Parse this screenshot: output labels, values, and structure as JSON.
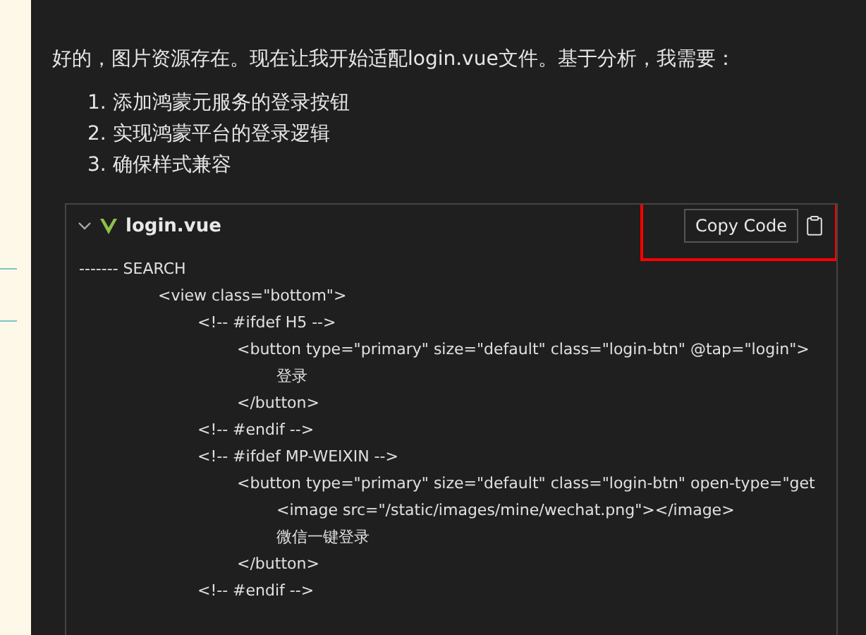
{
  "message": {
    "text": "好的，图片资源存在。现在让我开始适配login.vue文件。基于分析，我需要：",
    "steps": [
      "1. 添加鸿蒙元服务的登录按钮",
      "2. 实现鸿蒙平台的登录逻辑",
      "3. 确保样式兼容"
    ]
  },
  "code_block": {
    "filename": "login.vue",
    "expanded": true,
    "copy_label": "Copy Code",
    "highlighted": true,
    "lines": [
      {
        "text": "------- SEARCH",
        "children": [
          {
            "text": "<view class=\"bottom\">",
            "children": [
              {
                "text": "<!-- #ifdef H5 -->",
                "children": [
                  {
                    "text": "<button type=\"primary\" size=\"default\" class=\"login-btn\" @tap=\"login\">",
                    "children": [
                      {
                        "text": "登录"
                      }
                    ]
                  },
                  {
                    "text": "</button>"
                  }
                ]
              },
              {
                "text": "<!-- #endif -->"
              },
              {
                "text": "<!-- #ifdef MP-WEIXIN -->",
                "children": [
                  {
                    "text": "<button type=\"primary\" size=\"default\" class=\"login-btn\" open-type=\"get",
                    "children": [
                      {
                        "text": "<image src=\"/static/images/mine/wechat.png\"></image>"
                      },
                      {
                        "text": "微信一键登录"
                      }
                    ]
                  },
                  {
                    "text": "</button>"
                  }
                ]
              },
              {
                "text": "<!-- #endif -->"
              }
            ]
          }
        ]
      }
    ]
  }
}
